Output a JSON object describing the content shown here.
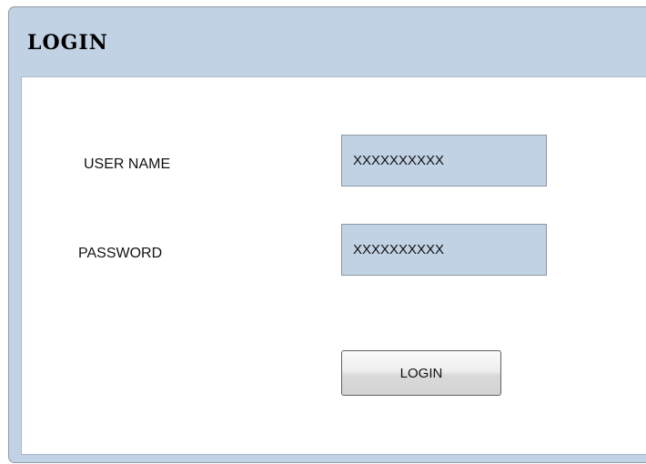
{
  "window": {
    "title": "LOGIN"
  },
  "form": {
    "username": {
      "label": "USER NAME",
      "value": "XXXXXXXXXX"
    },
    "password": {
      "label": "PASSWORD",
      "value": "XXXXXXXXXX"
    },
    "submit_label": "LOGIN"
  },
  "colors": {
    "frame": "#c1d2e4",
    "input_fill": "#c1d2e4",
    "content_bg": "#ffffff",
    "button_top": "#fbfbfb",
    "button_bottom": "#d3d3d3"
  }
}
